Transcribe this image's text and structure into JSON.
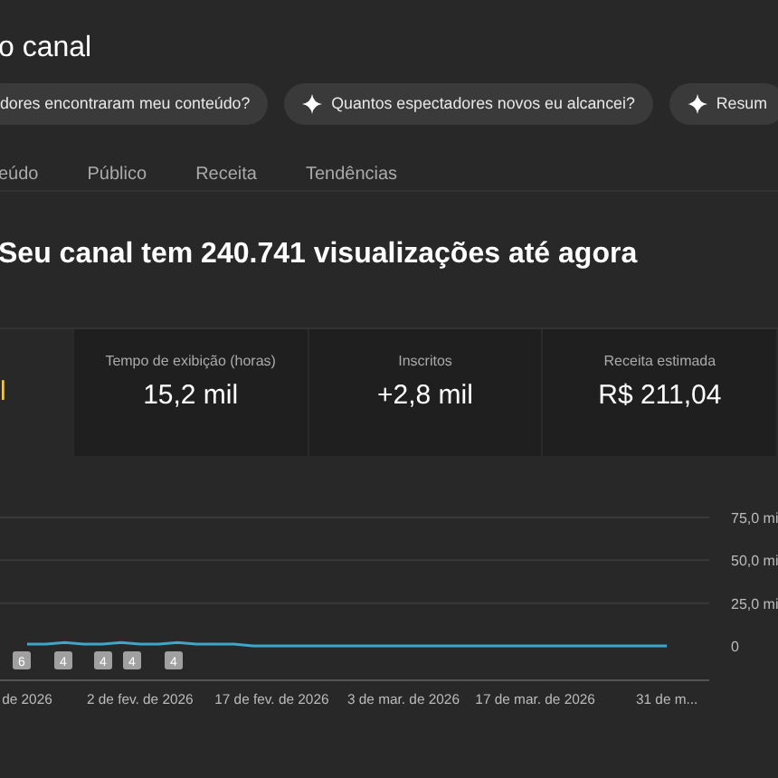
{
  "header": {
    "title": "o canal"
  },
  "chips": [
    {
      "label": "dores encontraram meu conteúdo?",
      "icon": false
    },
    {
      "label": "Quantos espectadores novos eu alcancei?",
      "icon": true
    },
    {
      "label": "Resum",
      "icon": true
    }
  ],
  "tabs": [
    {
      "label": "eúdo",
      "selected": false
    },
    {
      "label": "Público",
      "selected": false
    },
    {
      "label": "Receita",
      "selected": false
    },
    {
      "label": "Tendências",
      "selected": false
    }
  ],
  "headline": "Seu canal tem 240.741 visualizações até agora",
  "metrics": [
    {
      "value": "l",
      "selected": true
    },
    {
      "label": "Tempo de exibição (horas)",
      "value": "15,2 mil",
      "selected": false
    },
    {
      "label": "Inscritos",
      "value": "+2,8 mil",
      "selected": false
    },
    {
      "label": "Receita estimada",
      "value": "R$ 211,04",
      "selected": false
    }
  ],
  "chart": {
    "markers": [
      "6",
      "4",
      "4",
      "4",
      "4"
    ],
    "chart_data": {
      "type": "line",
      "ylim": [
        0,
        75
      ],
      "yticks": [
        {
          "value": 0,
          "label": "0"
        },
        {
          "value": 25,
          "label": "25,0 mi"
        },
        {
          "value": 50,
          "label": "50,0 mi"
        },
        {
          "value": 75,
          "label": "75,0 mi"
        }
      ],
      "categories": [
        "de 2026",
        null,
        null,
        null,
        null,
        null,
        "2 de fev. de 2026",
        null,
        null,
        null,
        null,
        null,
        null,
        "17 de fev. de 2026",
        null,
        null,
        null,
        null,
        null,
        null,
        "3 de mar. de 2026",
        null,
        null,
        null,
        null,
        null,
        null,
        "17 de mar. de 2026",
        null,
        null,
        null,
        null,
        null,
        null,
        "31 de m..."
      ],
      "series": [
        {
          "color": "#3ea6c8",
          "values": [
            1,
            1,
            2,
            1,
            1,
            2,
            1,
            1,
            2,
            1,
            1,
            1,
            0,
            0,
            0,
            0,
            0,
            0,
            0,
            0,
            0,
            0,
            0,
            0,
            0,
            0,
            0,
            0,
            0,
            0,
            0,
            0,
            0,
            0,
            0
          ]
        }
      ]
    }
  }
}
